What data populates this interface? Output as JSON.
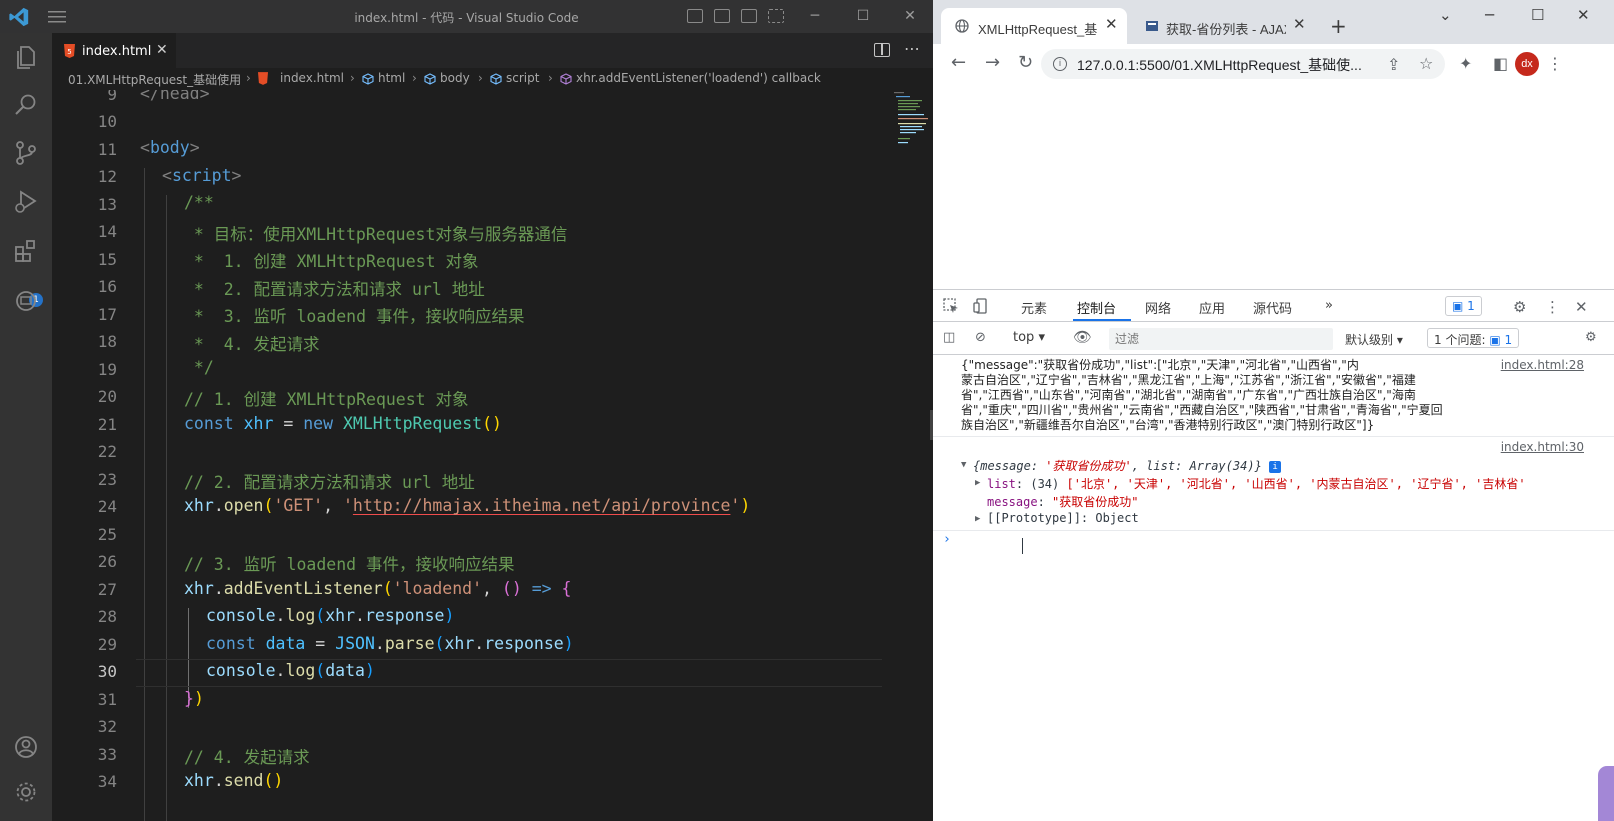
{
  "vscode": {
    "window_title": "index.html - 代码 - Visual Studio Code",
    "tab": {
      "label": "index.html",
      "close": "✕"
    },
    "breadcrumb": [
      "01.XMLHttpRequest_基础使用",
      "index.html",
      "html",
      "body",
      "script",
      "xhr.addEventListener('loadend') callback"
    ],
    "activity_badge": "1",
    "line_numbers": [
      "9",
      "10",
      "11",
      "12",
      "13",
      "14",
      "15",
      "16",
      "17",
      "18",
      "19",
      "20",
      "21",
      "22",
      "23",
      "24",
      "25",
      "26",
      "27",
      "28",
      "29",
      "30",
      "31",
      "32",
      "33",
      "34"
    ],
    "active_line": "30",
    "code": {
      "l9": "</head>",
      "l11_open": "<",
      "l11_tag": "body",
      "l11_close": ">",
      "l12_open": "<",
      "l12_tag": "script",
      "l12_close": ">",
      "l13": "/**",
      "l14": " * 目标：使用XMLHttpRequest对象与服务器通信",
      "l15": " *  1. 创建 XMLHttpRequest 对象",
      "l16": " *  2. 配置请求方法和请求 url 地址",
      "l17": " *  3. 监听 loadend 事件，接收响应结果",
      "l18": " *  4. 发起请求",
      "l19": " */",
      "l20": "// 1. 创建 XMLHttpRequest 对象",
      "l21_const": "const",
      "l21_var": "xhr",
      "l21_eq": " = ",
      "l21_new": "new",
      "l21_cls": "XMLHttpRequest",
      "l21_parens": "()",
      "l23": "// 2. 配置请求方法和请求 url 地址",
      "l24_obj": "xhr",
      "l24_dot": ".",
      "l24_fn": "open",
      "l24_p1": "(",
      "l24_s1": "'GET'",
      "l24_comma": ", ",
      "l24_q1": "'",
      "l24_url": "http://hmajax.itheima.net/api/province",
      "l24_q2": "'",
      "l24_p2": ")",
      "l26": "// 3. 监听 loadend 事件，接收响应结果",
      "l27_obj": "xhr",
      "l27_dot": ".",
      "l27_fn": "addEventListener",
      "l27_p1": "(",
      "l27_s1": "'loadend'",
      "l27_comma": ", ",
      "l27_args": "()",
      "l27_arrow": " => ",
      "l27_brace": "{",
      "l28_obj": "console",
      "l28_dot": ".",
      "l28_fn": "log",
      "l28_p1": "(",
      "l28_arg": "xhr",
      "l28_dot2": ".",
      "l28_prop": "response",
      "l28_p2": ")",
      "l29_const": "const",
      "l29_var": "data",
      "l29_eq": " = ",
      "l29_obj": "JSON",
      "l29_dot": ".",
      "l29_fn": "parse",
      "l29_p1": "(",
      "l29_arg": "xhr",
      "l29_dot2": ".",
      "l29_prop": "response",
      "l29_p2": ")",
      "l30_obj": "console",
      "l30_dot": ".",
      "l30_fn": "log",
      "l30_p1": "(",
      "l30_arg": "data",
      "l30_p2": ")",
      "l31_brace": "}",
      "l31_paren": ")",
      "l33": "// 4. 发起请求",
      "l34_obj": "xhr",
      "l34_dot": ".",
      "l34_fn": "send",
      "l34_parens": "()"
    }
  },
  "browser": {
    "tabs": [
      {
        "label": "XMLHttpRequest_基",
        "close": "✕"
      },
      {
        "label": "获取-省份列表 - AJAX",
        "close": "✕"
      }
    ],
    "new_tab": "+",
    "url": "127.0.0.1:5500/01.XMLHttpRequest_基础使...",
    "profile": "dx",
    "devtools": {
      "tabs": [
        "元素",
        "控制台",
        "网络",
        "应用",
        "源代码",
        "»"
      ],
      "active_tab": "控制台",
      "issues_count": "1",
      "context": "top",
      "filter_placeholder": "过滤",
      "level": "默认级别",
      "issues_label": "1 个问题:",
      "issues_badge": "1",
      "log1": {
        "text_lines": [
          "{\"message\":\"获取省份成功\",\"list\":[\"北京\",\"天津\",\"河北省\",\"山西省\",\"内",
          "蒙古自治区\",\"辽宁省\",\"吉林省\",\"黑龙江省\",\"上海\",\"江苏省\",\"浙江省\",\"安徽省\",\"福建",
          "省\",\"江西省\",\"山东省\",\"河南省\",\"湖北省\",\"湖南省\",\"广东省\",\"广西壮族自治区\",\"海南",
          "省\",\"重庆\",\"四川省\",\"贵州省\",\"云南省\",\"西藏自治区\",\"陕西省\",\"甘肃省\",\"青海省\",\"宁夏回",
          "族自治区\",\"新疆维吾尔自治区\",\"台湾\",\"香港特别行政区\",\"澳门特别行政区\"]}"
        ],
        "source": "index.html:28"
      },
      "log2": {
        "source": "index.html:30",
        "summary_open": "{",
        "summary_key1": "message",
        "summary_val1": "'获取省份成功'",
        "summary_mid": ", ",
        "summary_key2": "list",
        "summary_val2": "Array(34)",
        "summary_close": "}",
        "info_badge": "i",
        "list_key": "list",
        "list_count": "(34)",
        "list_preview": "['北京', '天津', '河北省', '山西省', '内蒙古自治区', '辽宁省', '吉林省'",
        "message_key": "message",
        "message_val": "\"获取省份成功\"",
        "proto_key": "[[Prototype]]",
        "proto_val": "Object"
      },
      "prompt": "›"
    }
  }
}
